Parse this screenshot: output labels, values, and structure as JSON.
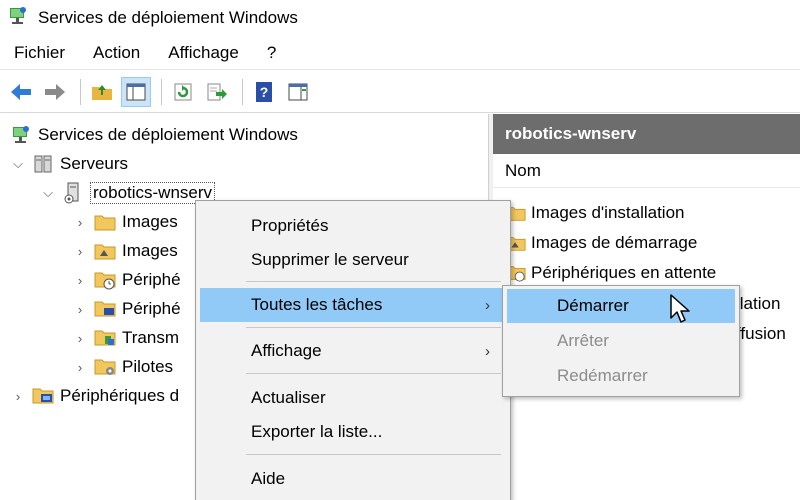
{
  "window": {
    "title": "Services de déploiement Windows",
    "app_icon": "wds-icon"
  },
  "menubar": [
    "Fichier",
    "Action",
    "Affichage",
    "?"
  ],
  "toolbar": {
    "buttons": [
      "back-arrow-icon",
      "forward-arrow-icon",
      "up-folder-icon",
      "show-hide-tree-icon",
      "refresh-icon",
      "export-list-icon",
      "help-icon",
      "console-pane-icon"
    ]
  },
  "tree": {
    "root": "Services de déploiement Windows",
    "servers": "Serveurs",
    "server": "robotics-wnserv",
    "children": [
      "Images",
      "Images",
      "Périphé",
      "Périphé",
      "Transm",
      "Pilotes"
    ],
    "active_directory": "Périphériques d"
  },
  "right_pane": {
    "header": "robotics-wnserv",
    "column": "Nom",
    "items": [
      "Images d'installation",
      "Images de démarrage",
      "Périphériques en attente"
    ],
    "partial": [
      "llation",
      "ffusion"
    ]
  },
  "context_menu": {
    "properties": "Propriétés",
    "delete_server": "Supprimer le serveur",
    "all_tasks": "Toutes les tâches",
    "view": "Affichage",
    "refresh": "Actualiser",
    "export": "Exporter la liste...",
    "help": "Aide",
    "arrow": "›"
  },
  "submenu": {
    "start": "Démarrer",
    "stop": "Arrêter",
    "restart": "Redémarrer"
  },
  "colors": {
    "highlight": "#91c9f7",
    "header_bg": "#6d6d6d",
    "menu_bg": "#f2f2f2",
    "disabled_text": "#8c8c8c"
  }
}
